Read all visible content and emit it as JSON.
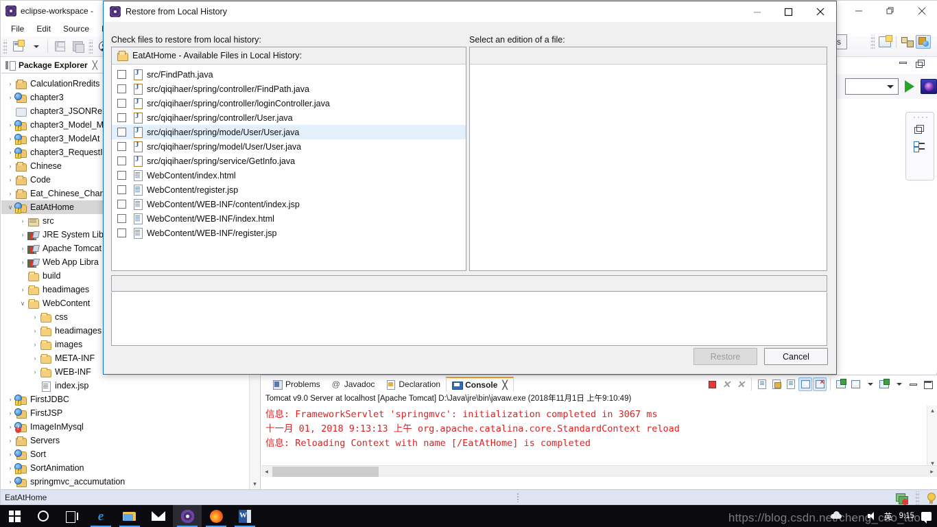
{
  "eclipse": {
    "title": "eclipse-workspace - ",
    "window_icon": "eclipse-icon",
    "menu": [
      "File",
      "Edit",
      "Source",
      "Ref"
    ],
    "toolbar": {
      "new_label": "new-wizard",
      "save_label": "save",
      "save_all_label": "save-all",
      "account_label": "account"
    },
    "access_button": "Access",
    "window_controls": {
      "minimize": "minimize",
      "restore": "restore",
      "close": "close"
    }
  },
  "package_explorer": {
    "tab_label": "Package Explorer",
    "tab_close": "╳",
    "tree": [
      {
        "label": "CalculationRredits",
        "icon": "project-folder-icon",
        "indent": 0,
        "twisty": "›",
        "kind": "proj"
      },
      {
        "label": "chapter3",
        "icon": "java-project-icon",
        "indent": 0,
        "twisty": "›",
        "kind": "projj"
      },
      {
        "label": "chapter3_JSONRe",
        "icon": "closed-project-icon",
        "indent": 0,
        "twisty": "",
        "kind": "plain"
      },
      {
        "label": "chapter3_Model_M",
        "icon": "java-project-icon",
        "indent": 0,
        "twisty": "›",
        "kind": "projj",
        "badge": "warning"
      },
      {
        "label": "chapter3_ModelAt",
        "icon": "java-project-icon",
        "indent": 0,
        "twisty": "›",
        "kind": "projj",
        "badge": "warning"
      },
      {
        "label": "chapter3_RequestI",
        "icon": "java-project-icon",
        "indent": 0,
        "twisty": "›",
        "kind": "projj",
        "badge": "warning"
      },
      {
        "label": "Chinese",
        "icon": "project-folder-icon",
        "indent": 0,
        "twisty": "›",
        "kind": "proj"
      },
      {
        "label": "Code",
        "icon": "project-folder-icon",
        "indent": 0,
        "twisty": "›",
        "kind": "proj"
      },
      {
        "label": "Eat_Chinese_Chara",
        "icon": "project-folder-icon",
        "indent": 0,
        "twisty": "›",
        "kind": "proj"
      },
      {
        "label": "EatAtHome",
        "icon": "java-project-icon",
        "indent": 0,
        "twisty": "∨",
        "kind": "projj",
        "badge": "warning",
        "selected": true
      },
      {
        "label": "src",
        "icon": "source-folder-icon",
        "indent": 1,
        "twisty": "›",
        "kind": "src"
      },
      {
        "label": "JRE System Libr",
        "icon": "library-icon",
        "indent": 1,
        "twisty": "›",
        "kind": "lib"
      },
      {
        "label": "Apache Tomcat",
        "icon": "library-icon",
        "indent": 1,
        "twisty": "›",
        "kind": "lib"
      },
      {
        "label": "Web App Libra",
        "icon": "library-icon",
        "indent": 1,
        "twisty": "›",
        "kind": "lib"
      },
      {
        "label": "build",
        "icon": "folder-icon",
        "indent": 1,
        "twisty": "",
        "kind": "folder"
      },
      {
        "label": "headimages",
        "icon": "folder-icon",
        "indent": 1,
        "twisty": "›",
        "kind": "folder"
      },
      {
        "label": "WebContent",
        "icon": "folder-icon",
        "indent": 1,
        "twisty": "∨",
        "kind": "folder"
      },
      {
        "label": "css",
        "icon": "folder-icon",
        "indent": 2,
        "twisty": "›",
        "kind": "folder"
      },
      {
        "label": "headimages",
        "icon": "folder-icon",
        "indent": 2,
        "twisty": "›",
        "kind": "folder"
      },
      {
        "label": "images",
        "icon": "folder-icon",
        "indent": 2,
        "twisty": "›",
        "kind": "folder"
      },
      {
        "label": "META-INF",
        "icon": "folder-icon",
        "indent": 2,
        "twisty": "›",
        "kind": "folder"
      },
      {
        "label": "WEB-INF",
        "icon": "folder-icon",
        "indent": 2,
        "twisty": "›",
        "kind": "folder"
      },
      {
        "label": "index.jsp",
        "icon": "jsp-file-icon",
        "indent": 2,
        "twisty": "",
        "kind": "file"
      },
      {
        "label": "FirstJDBC",
        "icon": "java-project-icon",
        "indent": 0,
        "twisty": "›",
        "kind": "projj",
        "badge": "warning"
      },
      {
        "label": "FirstJSP",
        "icon": "java-project-icon",
        "indent": 0,
        "twisty": "›",
        "kind": "projj"
      },
      {
        "label": "ImageInMysql",
        "icon": "java-project-icon",
        "indent": 0,
        "twisty": "›",
        "kind": "projj",
        "badge": "error"
      },
      {
        "label": "Servers",
        "icon": "project-folder-icon",
        "indent": 0,
        "twisty": "›",
        "kind": "proj"
      },
      {
        "label": "Sort",
        "icon": "java-project-icon",
        "indent": 0,
        "twisty": "›",
        "kind": "projj"
      },
      {
        "label": "SortAnimation",
        "icon": "java-project-icon",
        "indent": 0,
        "twisty": "›",
        "kind": "projj",
        "badge": "warning"
      },
      {
        "label": "springmvc_accumutation",
        "icon": "java-project-icon",
        "indent": 0,
        "twisty": "›",
        "kind": "projj"
      }
    ]
  },
  "dialog": {
    "title": "Restore from Local History",
    "icon": "eclipse-icon",
    "window_controls": {
      "minimize": "minimize",
      "maximize": "maximize",
      "close": "close"
    },
    "left_label": "Check files to restore from local history:",
    "right_label": "Select an edition of a file:",
    "files_header": "EatAtHome - Available Files in Local History:",
    "files": [
      {
        "path": "src/FindPath.java",
        "type": "java",
        "checked": false,
        "selected": false
      },
      {
        "path": "src/qiqihaer/spring/controller/FindPath.java",
        "type": "java",
        "checked": false,
        "selected": false
      },
      {
        "path": "src/qiqihaer/spring/controller/loginController.java",
        "type": "java",
        "checked": false,
        "selected": false
      },
      {
        "path": "src/qiqihaer/spring/controller/User.java",
        "type": "java",
        "checked": false,
        "selected": false
      },
      {
        "path": "src/qiqihaer/spring/mode/User/User.java",
        "type": "java",
        "checked": false,
        "selected": true
      },
      {
        "path": "src/qiqihaer/spring/model/User/User.java",
        "type": "java",
        "checked": false,
        "selected": false
      },
      {
        "path": "src/qiqihaer/spring/service/GetInfo.java",
        "type": "java",
        "checked": false,
        "selected": false
      },
      {
        "path": "WebContent/index.html",
        "type": "web",
        "checked": false,
        "selected": false
      },
      {
        "path": "WebContent/register.jsp",
        "type": "web",
        "checked": false,
        "selected": false
      },
      {
        "path": "WebContent/WEB-INF/content/index.jsp",
        "type": "web",
        "checked": false,
        "selected": false
      },
      {
        "path": "WebContent/WEB-INF/index.html",
        "type": "web",
        "checked": false,
        "selected": false
      },
      {
        "path": "WebContent/WEB-INF/register.jsp",
        "type": "web",
        "checked": false,
        "selected": false
      }
    ],
    "restore_button": "Restore",
    "restore_disabled": true,
    "cancel_button": "Cancel"
  },
  "console": {
    "tabs": [
      {
        "label": "Problems",
        "icon": "problems-icon",
        "active": false
      },
      {
        "label": "Javadoc",
        "icon": "javadoc-icon",
        "active": false
      },
      {
        "label": "Declaration",
        "icon": "declaration-icon",
        "active": false
      },
      {
        "label": "Console",
        "icon": "console-icon",
        "active": true
      }
    ],
    "tab_close": "╳",
    "header": "Tomcat v9.0 Server at localhost [Apache Tomcat] D:\\Java\\jre\\bin\\javaw.exe (2018年11月1日 上午9:10:49)",
    "lines": [
      "信息: FrameworkServlet 'springmvc': initialization completed in 3067 ms",
      "十一月 01, 2018 9:13:13 上午 org.apache.catalina.core.StandardContext reload",
      "信息: Reloading Context with name [/EatAtHome] is completed"
    ],
    "text_color": "#e02020",
    "toolbar_icons": [
      "terminate-icon",
      "remove-launch-icon",
      "remove-all-launches-icon",
      "clear-console-icon",
      "scroll-lock-icon",
      "show-console-on-output-icon",
      "pin-console-icon",
      "display-selected-console-icon",
      "new-console-view-icon",
      "open-console-icon",
      "minimize-icon",
      "maximize-icon"
    ]
  },
  "status_bar": {
    "text": "EatAtHome",
    "right_icons": [
      "build-stack-icon",
      "tip-bulb-icon"
    ]
  },
  "taskbar": {
    "items": [
      {
        "name": "start-button",
        "icon": "windows-logo-icon",
        "active": false
      },
      {
        "name": "cortana-button",
        "icon": "cortana-circle-icon",
        "active": false
      },
      {
        "name": "task-view-button",
        "icon": "task-view-icon",
        "active": false
      },
      {
        "name": "edge-button",
        "icon": "edge-icon",
        "active": false
      },
      {
        "name": "file-explorer-button",
        "icon": "file-explorer-icon",
        "active": true
      },
      {
        "name": "mail-button",
        "icon": "mail-icon",
        "active": false
      },
      {
        "name": "eclipse-button",
        "icon": "eclipse-icon",
        "active": true
      },
      {
        "name": "firefox-button",
        "icon": "firefox-icon",
        "active": true
      },
      {
        "name": "word-button",
        "icon": "word-icon",
        "active": true
      }
    ],
    "tray": {
      "icons": [
        "onedrive-icon",
        "wifi-icon",
        "volume-icon"
      ],
      "ime": "英",
      "clock": "9:15"
    },
    "watermark": "https://blog.csdn.net/cheng_cuo_tuo"
  }
}
